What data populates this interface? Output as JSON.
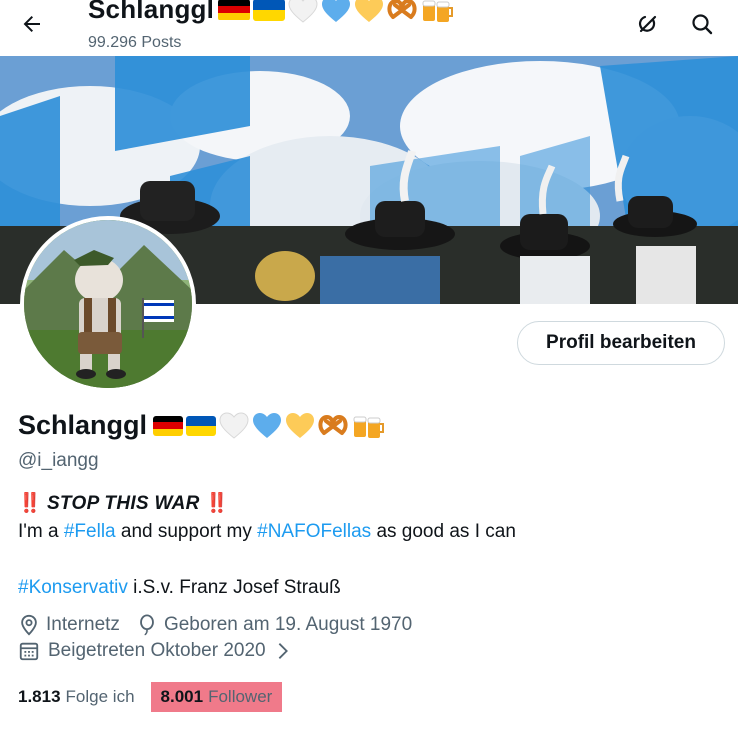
{
  "header": {
    "title": "Schlanggl",
    "posts": "99.296 Posts",
    "back_icon": "arrow-left-icon",
    "grok_icon": "grok-icon",
    "search_icon": "search-icon"
  },
  "profile": {
    "name": "Schlanggl",
    "handle": "@i_iangg",
    "edit_button": "Profil bearbeiten",
    "emojis": [
      "flag-germany",
      "flag-ukraine",
      "white-heart",
      "blue-heart",
      "yellow-heart",
      "pretzel",
      "beer-mugs"
    ]
  },
  "bio": {
    "bang1": "‼️",
    "stop": "STOP THIS WAR",
    "bang2": "‼️",
    "line2_pre": "I'm a ",
    "tag_fella": "#Fella",
    "line2_mid": " and support my ",
    "tag_nafo": "#NAFOFellas",
    "line2_post": " as good as I can",
    "tag_konservativ": "#Konservativ",
    "line3_post": " i.S.v. Franz Josef Strauß"
  },
  "meta": {
    "location": "Internetz",
    "birthday": "Geboren am 19. August 1970",
    "joined": "Beigetreten Oktober 2020"
  },
  "stats": {
    "following_count": "1.813",
    "following_label": "Folge ich",
    "followers_count": "8.001",
    "followers_label": "Follower"
  },
  "colors": {
    "accent": "#1d9bf0",
    "text": "#0f1419",
    "muted": "#536471",
    "highlight": "#f07a8a"
  }
}
